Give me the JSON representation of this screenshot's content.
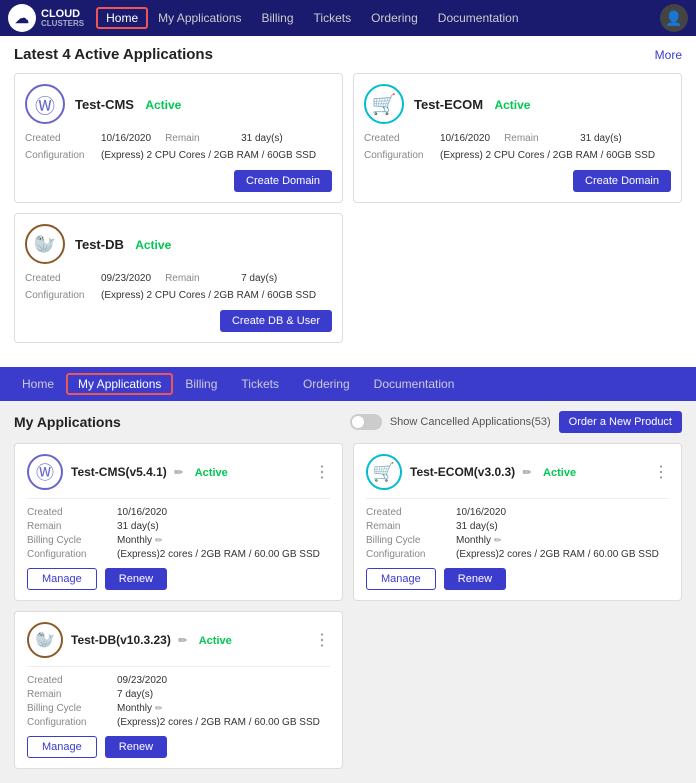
{
  "brand": {
    "cloud": "CLOUD",
    "clusters": "CLUSTERS",
    "icon": "☁"
  },
  "topNav": {
    "links": [
      {
        "label": "Home",
        "active": true
      },
      {
        "label": "My Applications",
        "active": false
      },
      {
        "label": "Billing",
        "active": false
      },
      {
        "label": "Tickets",
        "active": false
      },
      {
        "label": "Ordering",
        "active": false
      },
      {
        "label": "Documentation",
        "active": false
      }
    ]
  },
  "section1": {
    "title": "Latest 4 Active Applications",
    "moreLabel": "More",
    "cards": [
      {
        "name": "Test-CMS",
        "status": "Active",
        "iconType": "wp",
        "created": "10/16/2020",
        "remain": "31 day(s)",
        "configuration": "(Express) 2 CPU Cores / 2GB RAM / 60GB SSD",
        "btnLabel": "Create Domain"
      },
      {
        "name": "Test-ECOM",
        "status": "Active",
        "iconType": "cart",
        "created": "10/16/2020",
        "remain": "31 day(s)",
        "configuration": "(Express) 2 CPU Cores / 2GB RAM / 60GB SSD",
        "btnLabel": "Create Domain"
      }
    ],
    "card_single": {
      "name": "Test-DB",
      "status": "Active",
      "iconType": "db",
      "created": "09/23/2020",
      "remain": "7 day(s)",
      "configuration": "(Express) 2 CPU Cores / 2GB RAM / 60GB SSD",
      "btnLabel": "Create DB & User"
    }
  },
  "secondNav": {
    "links": [
      {
        "label": "Home",
        "active": false
      },
      {
        "label": "My Applications",
        "active": true
      },
      {
        "label": "Billing",
        "active": false
      },
      {
        "label": "Tickets",
        "active": false
      },
      {
        "label": "Ordering",
        "active": false
      },
      {
        "label": "Documentation",
        "active": false
      }
    ]
  },
  "section2": {
    "title": "My Applications",
    "toggleLabel": "Show Cancelled Applications(53)",
    "orderBtn": "Order a New Product",
    "apps": [
      {
        "name": "Test-CMS(v5.4.1)",
        "status": "Active",
        "iconType": "wp",
        "created": "10/16/2020",
        "remain": "31 day(s)",
        "billingCycle": "Monthly",
        "configuration": "(Express)2 cores / 2GB RAM / 60.00 GB SSD"
      },
      {
        "name": "Test-ECOM(v3.0.3)",
        "status": "Active",
        "iconType": "cart",
        "created": "10/16/2020",
        "remain": "31 day(s)",
        "billingCycle": "Monthly",
        "configuration": "(Express)2 cores / 2GB RAM / 60.00 GB SSD"
      },
      {
        "name": "Test-DB(v10.3.23)",
        "status": "Active",
        "iconType": "db",
        "created": "09/23/2020",
        "remain": "7 day(s)",
        "billingCycle": "Monthly",
        "configuration": "(Express)2 cores / 2GB RAM / 60.00 GB SSD"
      }
    ],
    "manageBtnLabel": "Manage",
    "renewBtnLabel": "Renew",
    "createdLabel": "Created",
    "remainLabel": "Remain",
    "billingLabel": "Billing Cycle",
    "configLabel": "Configuration"
  }
}
